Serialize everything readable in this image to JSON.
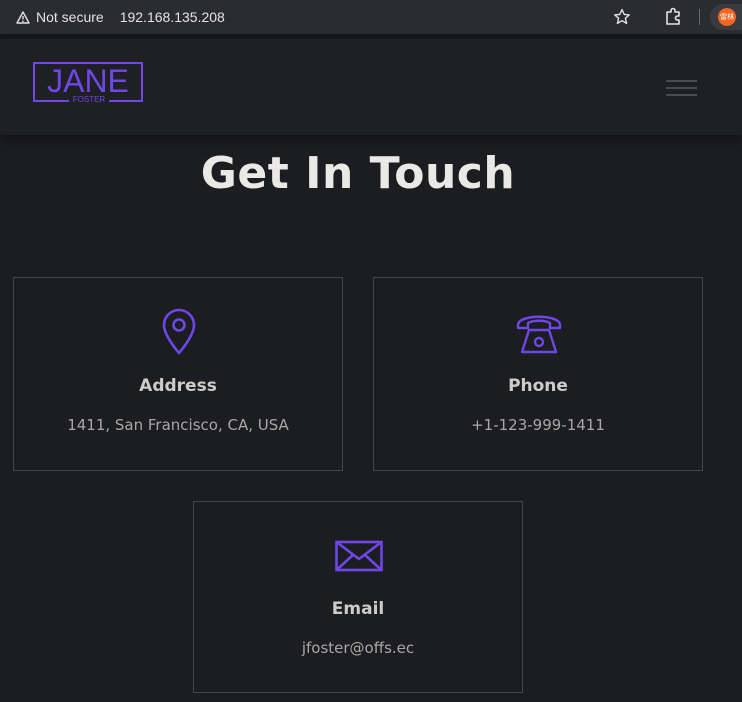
{
  "browser": {
    "security_label": "Not secure",
    "url": "192.168.135.208",
    "profile_label": "雷林"
  },
  "site": {
    "logo_main": "JANE",
    "logo_sub": "FOSTER"
  },
  "contact": {
    "title": "Get In Touch",
    "cards": [
      {
        "heading": "Address",
        "text": "1411, San Francisco, CA, USA",
        "icon": "map-pin-icon"
      },
      {
        "heading": "Phone",
        "text": "+1-123-999-1411",
        "icon": "telephone-icon"
      },
      {
        "heading": "Email",
        "text": "jfoster@offs.ec",
        "icon": "envelope-icon"
      }
    ]
  },
  "colors": {
    "accent": "#6f46e8",
    "background": "#1c1d21",
    "header": "#1f2024"
  }
}
